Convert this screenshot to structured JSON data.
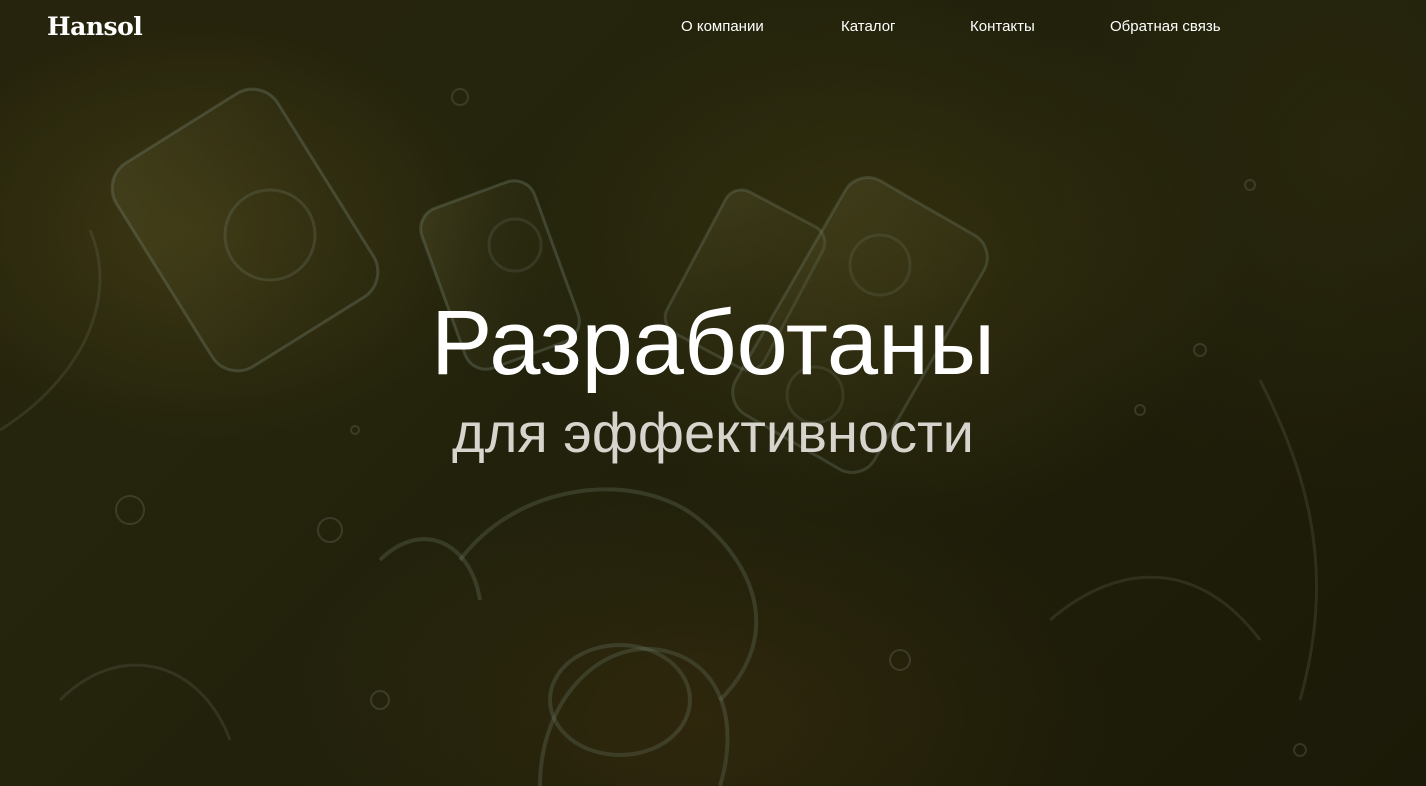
{
  "header": {
    "logo_text": "Hansol",
    "nav": [
      {
        "label": "О компании"
      },
      {
        "label": "Каталог"
      },
      {
        "label": "Контакты"
      },
      {
        "label": "Обратная связь"
      }
    ]
  },
  "hero": {
    "title": "Разработаны",
    "subtitle": "для эффективности",
    "background_image": "engine-in-oil-splash"
  },
  "colors": {
    "background": "#2a2a10",
    "text": "#ffffff",
    "subtitle_text": "#d6d4cc"
  }
}
